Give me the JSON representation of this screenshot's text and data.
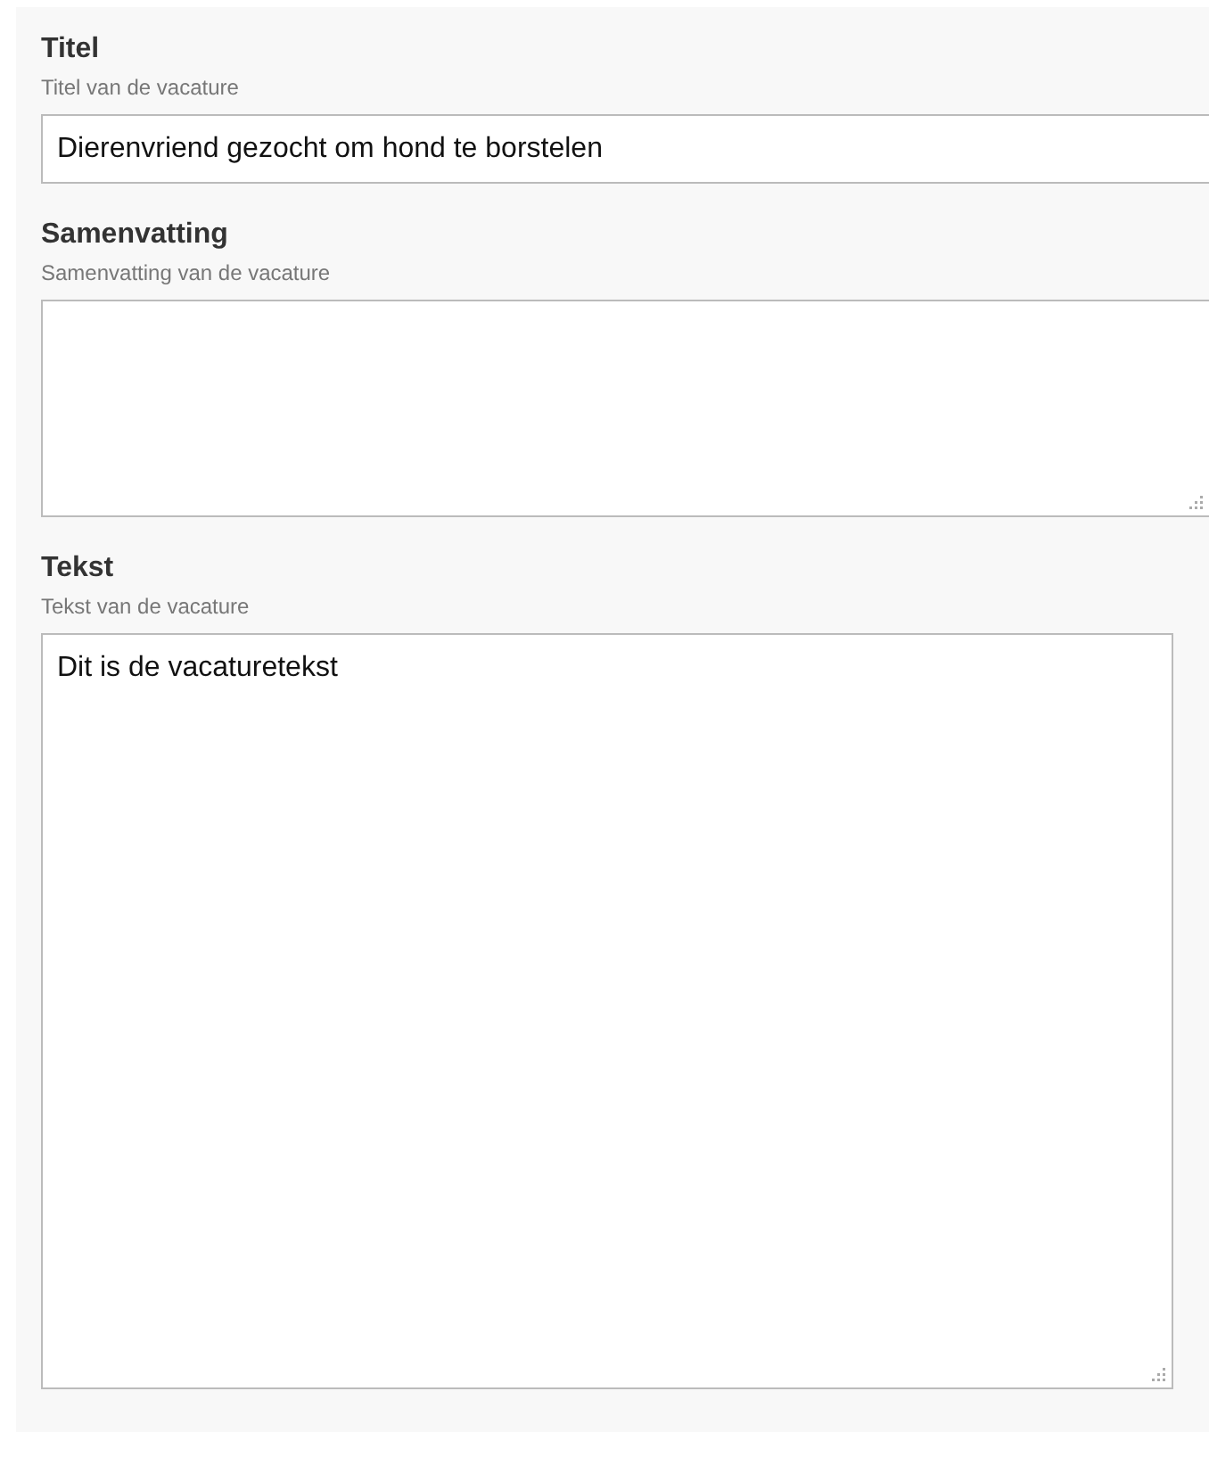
{
  "fields": [
    {
      "kind": "input",
      "label": "Titel",
      "hint": "Titel van de vacature",
      "value": "Dierenvriend gezocht om hond te borstelen"
    },
    {
      "kind": "textarea",
      "label": "Samenvatting",
      "hint": "Samenvatting van de vacature"
    },
    {
      "kind": "textarea",
      "label": "Tekst",
      "hint": "Tekst van de vacature",
      "value": "Dit is de vacaturetekst"
    }
  ]
}
